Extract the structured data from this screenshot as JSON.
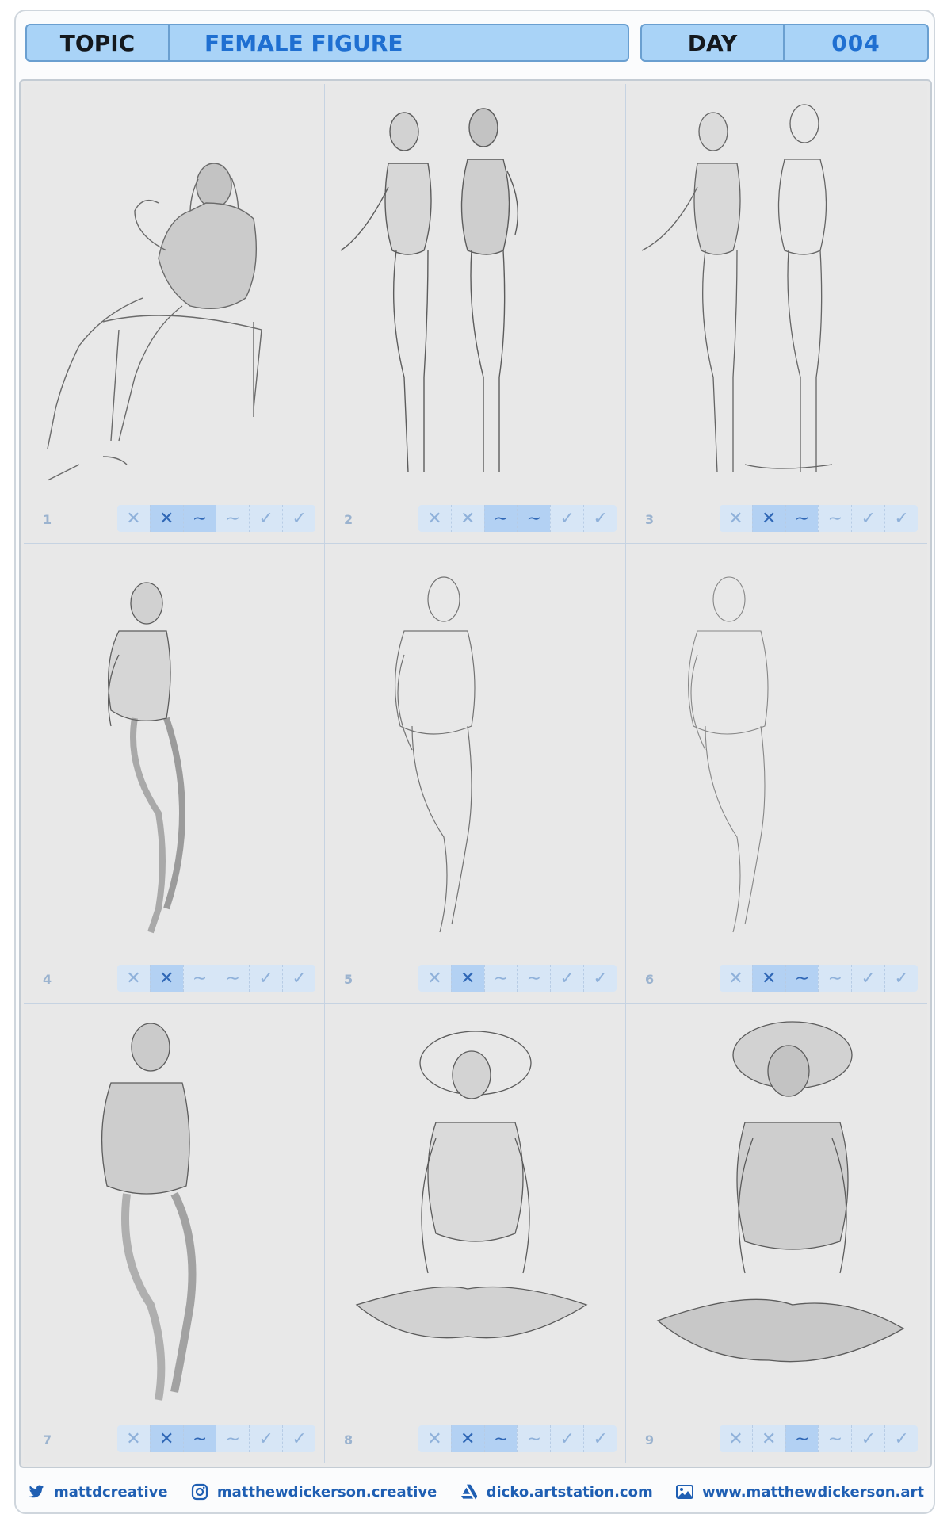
{
  "header": {
    "topic_label": "TOPIC",
    "topic_value": "FEMALE FIGURE",
    "day_label": "DAY",
    "day_value": "004"
  },
  "rating_symbols": [
    "✕",
    "✕",
    "∼",
    "∼",
    "✓",
    "✓"
  ],
  "cells": [
    {
      "number": "1",
      "rating": [
        false,
        true,
        true,
        false,
        false,
        false
      ]
    },
    {
      "number": "2",
      "rating": [
        false,
        false,
        true,
        true,
        false,
        false
      ]
    },
    {
      "number": "3",
      "rating": [
        false,
        true,
        true,
        false,
        false,
        false
      ]
    },
    {
      "number": "4",
      "rating": [
        false,
        true,
        false,
        false,
        false,
        false
      ]
    },
    {
      "number": "5",
      "rating": [
        false,
        true,
        false,
        false,
        false,
        false
      ]
    },
    {
      "number": "6",
      "rating": [
        false,
        true,
        true,
        false,
        false,
        false
      ]
    },
    {
      "number": "7",
      "rating": [
        false,
        true,
        true,
        false,
        false,
        false
      ]
    },
    {
      "number": "8",
      "rating": [
        false,
        true,
        true,
        false,
        false,
        false
      ]
    },
    {
      "number": "9",
      "rating": [
        false,
        false,
        true,
        false,
        false,
        false
      ]
    }
  ],
  "footer": {
    "twitter": "mattdcreative",
    "instagram": "matthewdickerson.creative",
    "artstation": "dicko.artstation.com",
    "website": "www.matthewdickerson.art"
  },
  "colors": {
    "accent": "#1f6fd1",
    "header_bg": "#a9d3f7",
    "rating_bg": "#d7e6f6",
    "rating_on": "#b3d1f3"
  },
  "icons": [
    "twitter-icon",
    "instagram-icon",
    "artstation-icon",
    "image-icon"
  ]
}
